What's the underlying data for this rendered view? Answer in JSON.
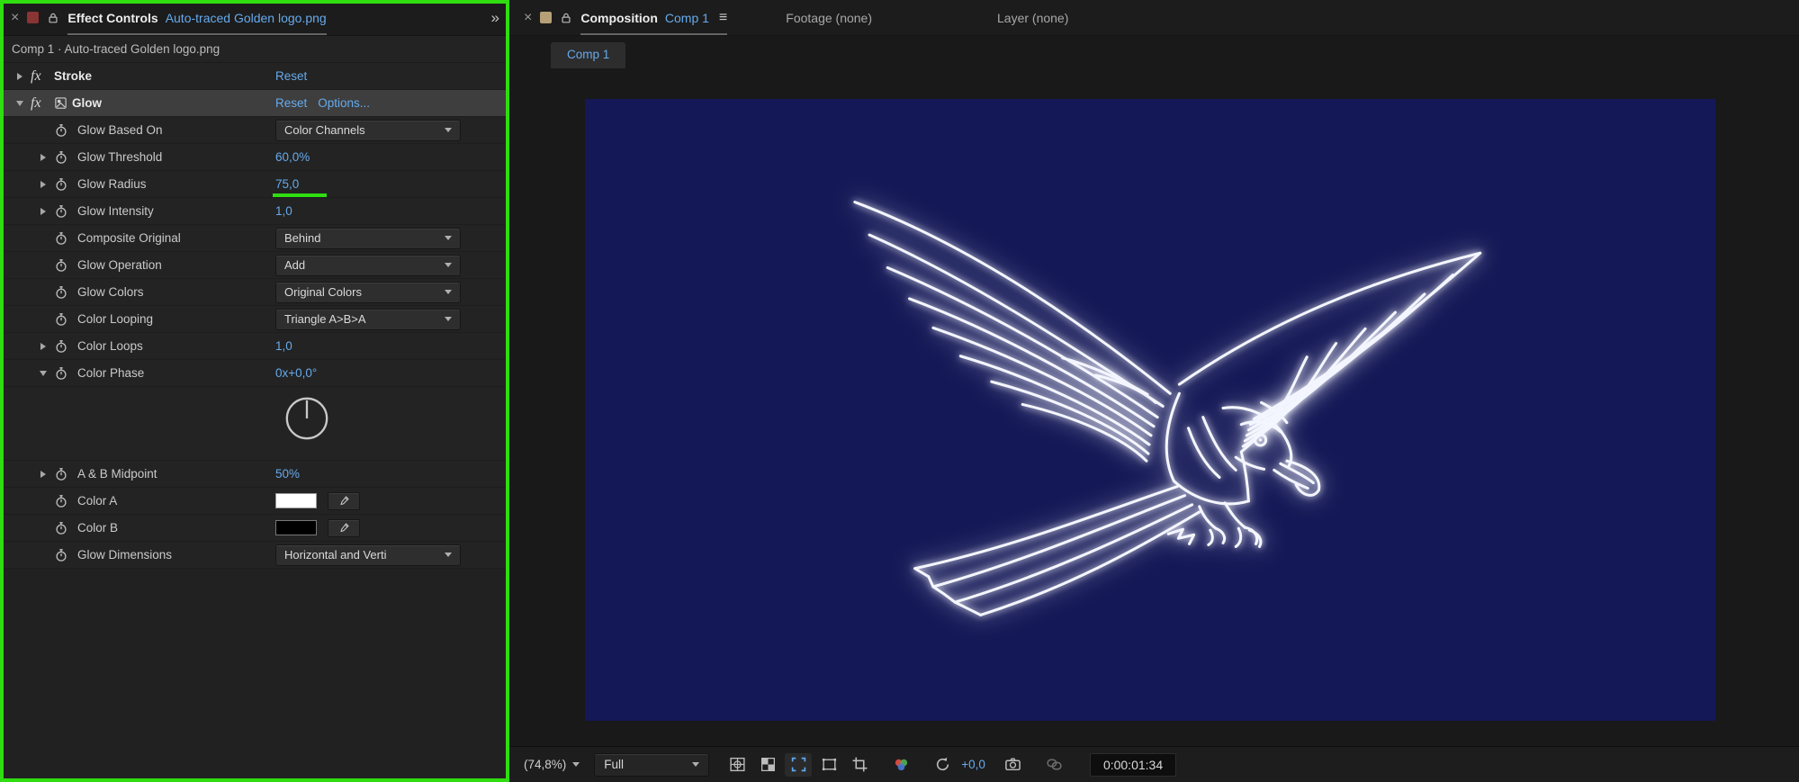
{
  "colors": {
    "accent_blue": "#66aaec",
    "annotation_green": "#2fdd10",
    "comp_background": "#141856",
    "panel_background": "#232323",
    "selected_row": "#3e3e3e"
  },
  "glyphs": {
    "close": "×",
    "overflow": "»",
    "menu": "≡",
    "fx": "fx"
  },
  "effect_controls": {
    "tab_title": "Effect Controls",
    "tab_doc": "Auto-traced Golden logo.png",
    "breadcrumb": "Comp 1 · Auto-traced Golden logo.png",
    "stroke_effect": {
      "name": "Stroke",
      "reset": "Reset"
    },
    "glow_effect": {
      "name": "Glow",
      "reset": "Reset",
      "options": "Options..."
    },
    "params": [
      {
        "label": "Glow Based On",
        "value": "Color Channels"
      },
      {
        "label": "Glow Threshold",
        "value": "60,0%"
      },
      {
        "label": "Glow Radius",
        "value": "75,0"
      },
      {
        "label": "Glow Intensity",
        "value": "1,0"
      },
      {
        "label": "Composite Original",
        "value": "Behind"
      },
      {
        "label": "Glow Operation",
        "value": "Add"
      },
      {
        "label": "Glow Colors",
        "value": "Original Colors"
      },
      {
        "label": "Color Looping",
        "value": "Triangle A>B>A"
      },
      {
        "label": "Color Loops",
        "value": "1,0"
      },
      {
        "label": "Color Phase",
        "value": "0x+0,0°"
      },
      {
        "label": "A & B Midpoint",
        "value": "50%"
      },
      {
        "label": "Color A",
        "swatch": "#ffffff"
      },
      {
        "label": "Color B",
        "swatch": "#000000"
      },
      {
        "label": "Glow Dimensions",
        "value": "Horizontal and Verti"
      }
    ]
  },
  "viewer": {
    "tabs": [
      {
        "label": "Composition",
        "doc": "Comp 1",
        "active": true
      },
      {
        "label": "Footage (none)",
        "active": false
      },
      {
        "label": "Layer (none)",
        "active": false
      }
    ],
    "comp_tab": "Comp 1",
    "toolbar": {
      "zoom": "(74,8%)",
      "resolution": "Full",
      "exposure": "+0,0",
      "timecode": "0:00:01:34"
    }
  }
}
